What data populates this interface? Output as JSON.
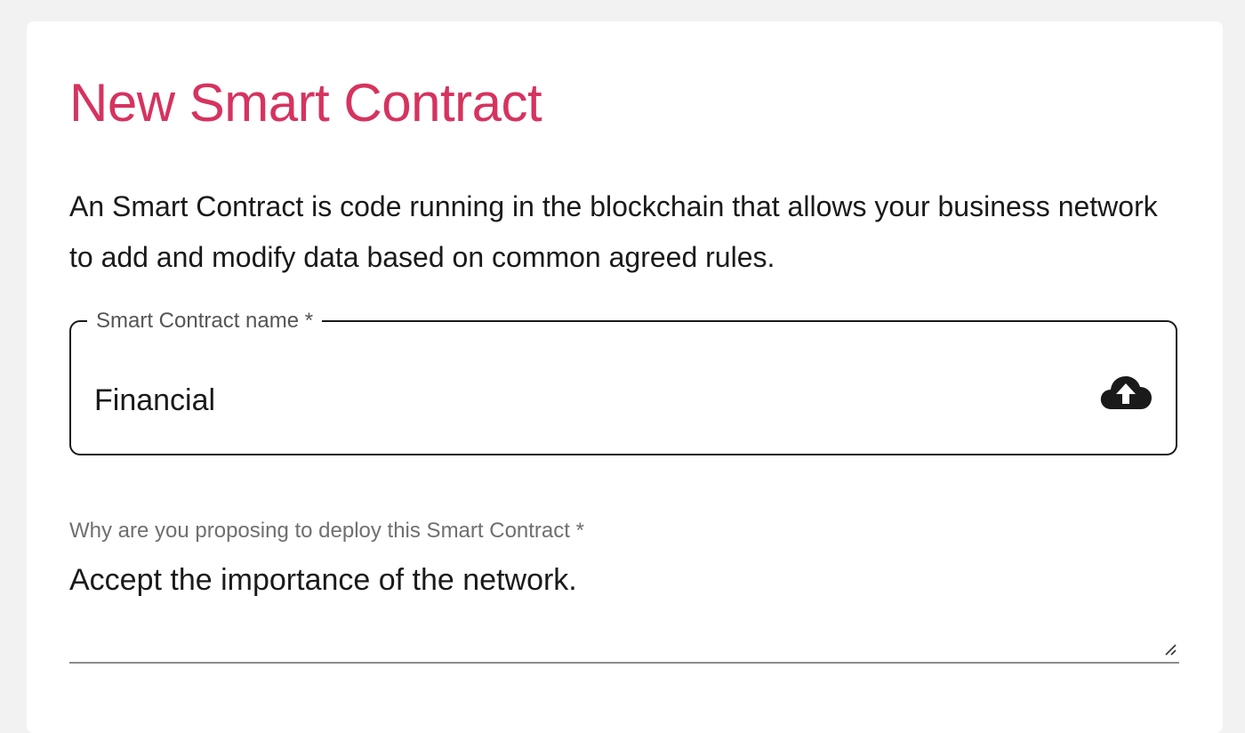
{
  "colors": {
    "title": "#d6335f",
    "text": "#1a1a1a",
    "label": "#6f6f6f",
    "border": "#1a1a1a"
  },
  "form": {
    "title": "New Smart Contract",
    "intro": "An Smart Contract is code running in the blockchain that allows your business network to add and modify data based on common agreed rules.",
    "name_field": {
      "label": "Smart Contract name *",
      "value": "Financial",
      "icon": "cloud-upload-icon"
    },
    "reason_field": {
      "label": "Why are you proposing to deploy this Smart Contract *",
      "value": "Accept the importance of the network."
    }
  }
}
